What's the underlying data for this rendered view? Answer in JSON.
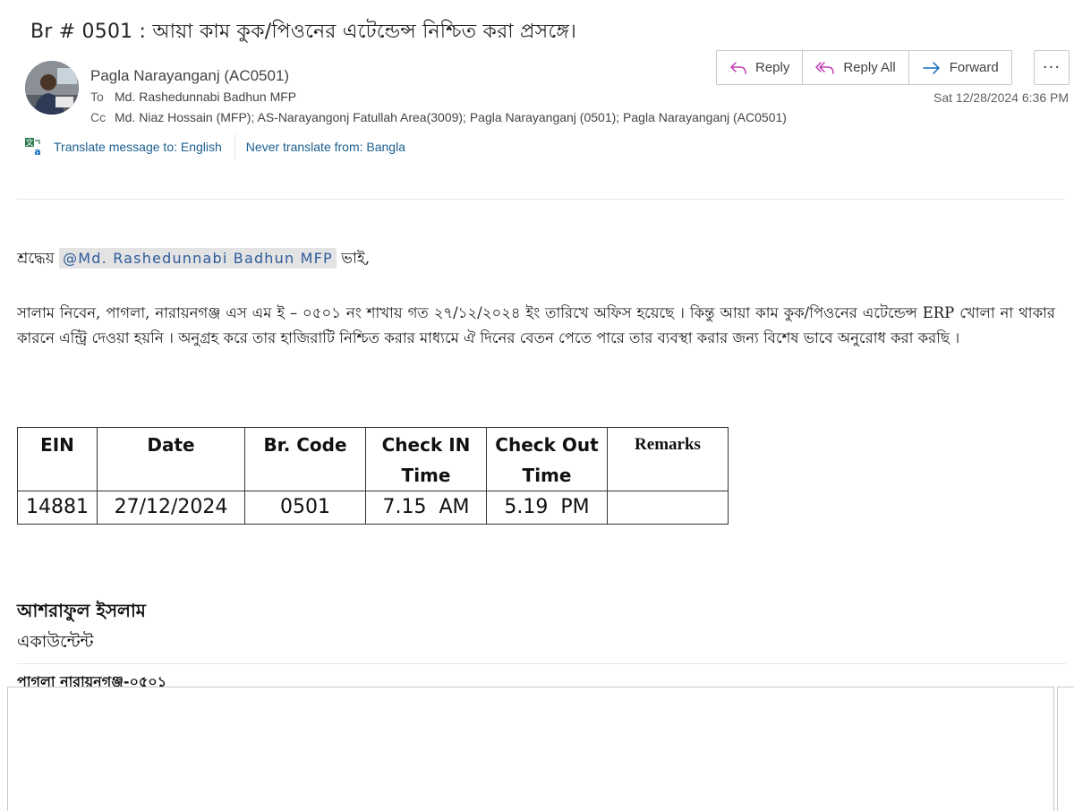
{
  "email": {
    "subject": "Br # 0501 : আয়া কাম কুক/পিওনের এটেন্ডেন্স নিশ্চিত করা প্রসঙ্গে।",
    "sender": "Pagla Narayanganj (AC0501)",
    "to_label": "To",
    "to": "Md. Rashedunnabi Badhun MFP",
    "cc_label": "Cc",
    "cc": "Md. Niaz Hossain (MFP); AS-Narayangonj Fatullah Area(3009); Pagla Narayanganj (0501); Pagla Narayanganj (AC0501)",
    "date": "Sat 12/28/2024 6:36 PM"
  },
  "actions": {
    "reply": "Reply",
    "reply_all": "Reply All",
    "forward": "Forward",
    "more": "···"
  },
  "translate": {
    "translate_to": "Translate message to: English",
    "never_translate": "Never translate from: Bangla"
  },
  "body": {
    "salutation_prefix": "শ্রদ্ধেয়",
    "mention": "@Md. Rashedunnabi Badhun MFP",
    "salutation_suffix": "ভাই,",
    "paragraph": "সালাম নিবেন, পাগলা, নারায়নগঞ্জ এস এম ই – ০৫০১ নং শাখায় গত ২৭/১২/২০২৪ ইং তারিখে অফিস হয়েছে । কিন্তু আয়া কাম কুক/পিওনের এটেন্ডেন্স ERP খোলা না থাকার কারনে এন্ট্রি  দেওয়া হয়নি । অনুগ্রহ করে তার হাজিরাটি নিশ্চিত করার মাধ্যমে ঐ দিনের বেতন পেতে পারে তার ব্যবস্থা করার জন্য বিশেষ ভাবে অনুরোধ করা করছি ।"
  },
  "table": {
    "headers": [
      "EIN",
      "Date",
      "Br. Code",
      "Check IN Time",
      "Check Out Time",
      "Remarks"
    ],
    "rows": [
      [
        "14881",
        "27/12/2024",
        "0501",
        "7.15  AM",
        "5.19  PM",
        ""
      ]
    ]
  },
  "signature": {
    "name": "আশরাফুল ইসলাম",
    "title": "একাউন্টেন্ট",
    "branch": "পাগলা নারায়নগঞ্জ-০৫০১"
  },
  "colors": {
    "link": "#1b5e8f",
    "mention_bg": "#e3e3e3",
    "mention_text": "#2d5b9a",
    "reply_icon": "#c239b3",
    "forward_icon": "#0f6cbd"
  }
}
